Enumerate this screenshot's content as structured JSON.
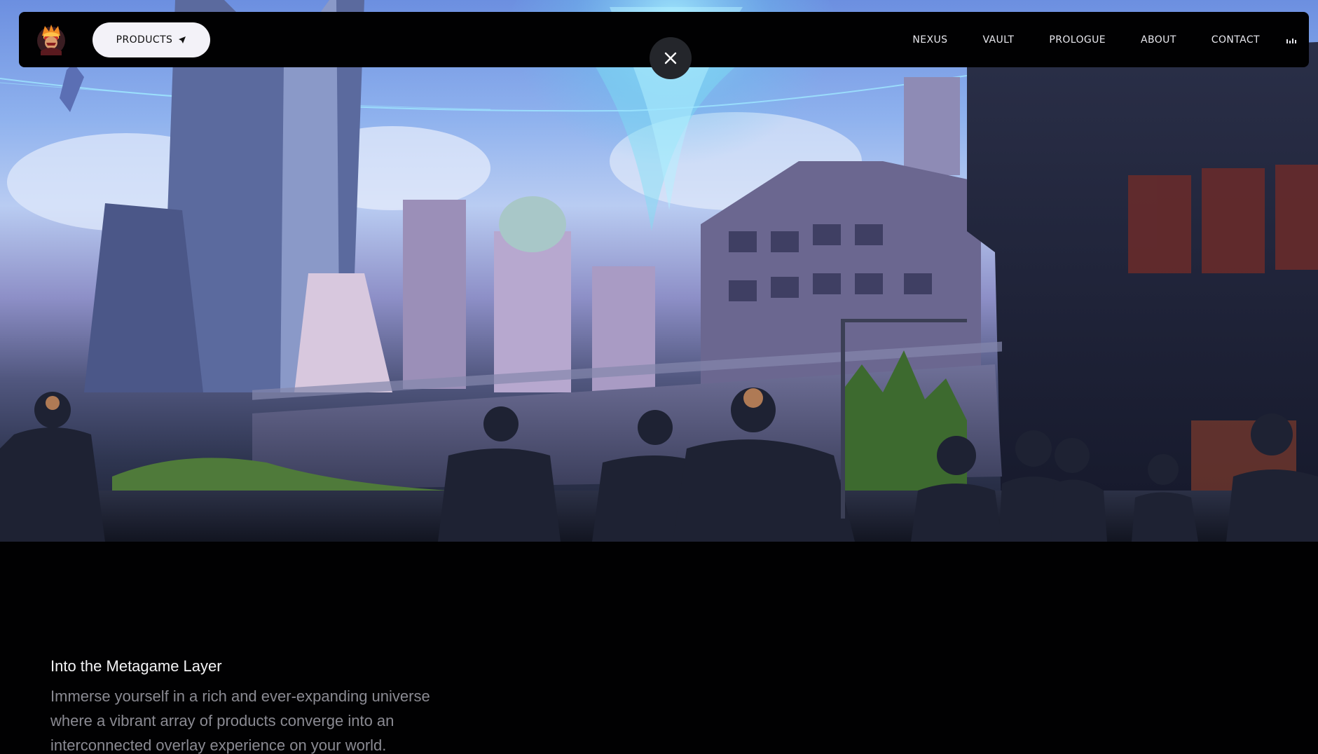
{
  "navbar": {
    "logo": {
      "icon": "brand-mascot-logo"
    },
    "products_button": {
      "label": "PRODUCTS",
      "icon": "send-arrow-icon"
    },
    "links": [
      "NEXUS",
      "VAULT",
      "PROLOGUE",
      "ABOUT",
      "CONTACT"
    ],
    "audio_icon": "audio-bars-icon"
  },
  "close_button": {
    "icon": "close-icon"
  },
  "hero": {
    "image": "city-plaza-illustration"
  },
  "content": {
    "heading": "Into the Metagame Layer",
    "body_lines": [
      "Immerse yourself in a rich and ever-expanding universe",
      "where a vibrant array of products converge into an",
      "interconnected overlay experience on your world."
    ]
  },
  "colors": {
    "background": "#010102",
    "nav_background": "#010102",
    "button_background": "#f3f2f8",
    "heading_text": "#f4f4f6",
    "body_text": "#8a8a92",
    "close_button_background": "#24262b"
  }
}
